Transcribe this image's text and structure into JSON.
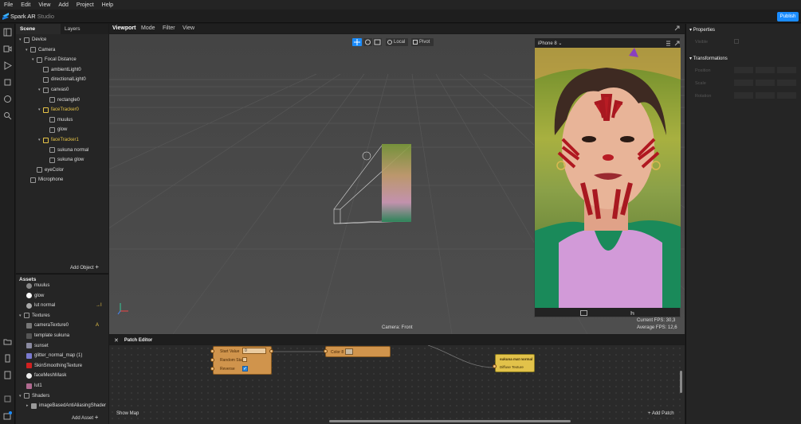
{
  "menu": [
    "File",
    "Edit",
    "View",
    "Add",
    "Project",
    "Help"
  ],
  "app": {
    "name_bold": "Spark AR",
    "name_light": "Studio",
    "publish": "Publish"
  },
  "scene_tabs": [
    "Scene",
    "Layers"
  ],
  "scene_tree": [
    {
      "label": "Device",
      "indent": 0,
      "arrow": "▾",
      "yellow": false
    },
    {
      "label": "Camera",
      "indent": 1,
      "arrow": "▾",
      "yellow": false
    },
    {
      "label": "Focal Distance",
      "indent": 2,
      "arrow": "▾",
      "yellow": false
    },
    {
      "label": "ambientLight0",
      "indent": 3,
      "arrow": "",
      "yellow": false
    },
    {
      "label": "directionalLight0",
      "indent": 3,
      "arrow": "",
      "yellow": false
    },
    {
      "label": "canvas0",
      "indent": 3,
      "arrow": "▾",
      "yellow": false
    },
    {
      "label": "rectangle0",
      "indent": 4,
      "arrow": "",
      "yellow": false
    },
    {
      "label": "faceTracker0",
      "indent": 3,
      "arrow": "▾",
      "yellow": true
    },
    {
      "label": "muulus",
      "indent": 4,
      "arrow": "",
      "yellow": false
    },
    {
      "label": "glow",
      "indent": 4,
      "arrow": "",
      "yellow": false
    },
    {
      "label": "faceTracker1",
      "indent": 3,
      "arrow": "▾",
      "yellow": true
    },
    {
      "label": "sukuna normal",
      "indent": 4,
      "arrow": "",
      "yellow": false
    },
    {
      "label": "sukuna glow",
      "indent": 4,
      "arrow": "",
      "yellow": false
    },
    {
      "label": "eyeColor",
      "indent": 2,
      "arrow": "",
      "yellow": false
    },
    {
      "label": "Microphone",
      "indent": 1,
      "arrow": "",
      "yellow": false
    }
  ],
  "add_object": "Add Object",
  "assets_title": "Assets",
  "assets": [
    {
      "label": "muulus",
      "indent": 1,
      "color": "#888"
    },
    {
      "label": "glow",
      "indent": 1,
      "color": "#fff"
    },
    {
      "label": "lut normal",
      "indent": 1,
      "color": "#aaa",
      "badge": "→I"
    },
    {
      "label": "Textures",
      "indent": 0,
      "color": "",
      "arrow": "▾"
    },
    {
      "label": "cameraTexture0",
      "indent": 1,
      "color": "#777",
      "badge": "A"
    },
    {
      "label": "template sukuna",
      "indent": 1,
      "color": "#555"
    },
    {
      "label": "sunset",
      "indent": 1,
      "color": "#8a8aa0"
    },
    {
      "label": "glitter_normal_map (1)",
      "indent": 1,
      "color": "#7a7ad0"
    },
    {
      "label": "SkinSmoothingTexture",
      "indent": 1,
      "color": "#d02020"
    },
    {
      "label": "faceMeshMask",
      "indent": 1,
      "color": "#eee"
    },
    {
      "label": "lut1",
      "indent": 1,
      "color": "#b06a90"
    },
    {
      "label": "Shaders",
      "indent": 0,
      "color": "",
      "arrow": "▾"
    },
    {
      "label": "imageBasedAntiAliasingShader",
      "indent": 1,
      "color": "#999",
      "arrow": "▸"
    }
  ],
  "add_asset": "Add Asset",
  "viewport_tabs": [
    "Viewport",
    "Mode",
    "Filter",
    "View"
  ],
  "viewport_toolbar": {
    "local": "Local",
    "pivot": "Pivot"
  },
  "simulator": {
    "device": "iPhone 8"
  },
  "camera_label": "Camera: Front",
  "fps": {
    "current": "Current FPS: 30,3",
    "average": "Average FPS: 12,6"
  },
  "patch_editor": {
    "title": "Patch Editor",
    "show_map": "Show Map",
    "add_patch": "Add Patch",
    "node1": {
      "rows": [
        "Start Value",
        "Random Start",
        "Reverse"
      ],
      "value": "0"
    },
    "node2": {
      "label": "Color 8"
    },
    "node3": {
      "title": "sukuna mat normal",
      "port": "Diffuse Texture"
    }
  },
  "properties": {
    "title": "Properties",
    "visible": "Visible",
    "transformations": "Transformations",
    "rows": [
      "Position",
      "Scale",
      "Rotation"
    ]
  }
}
